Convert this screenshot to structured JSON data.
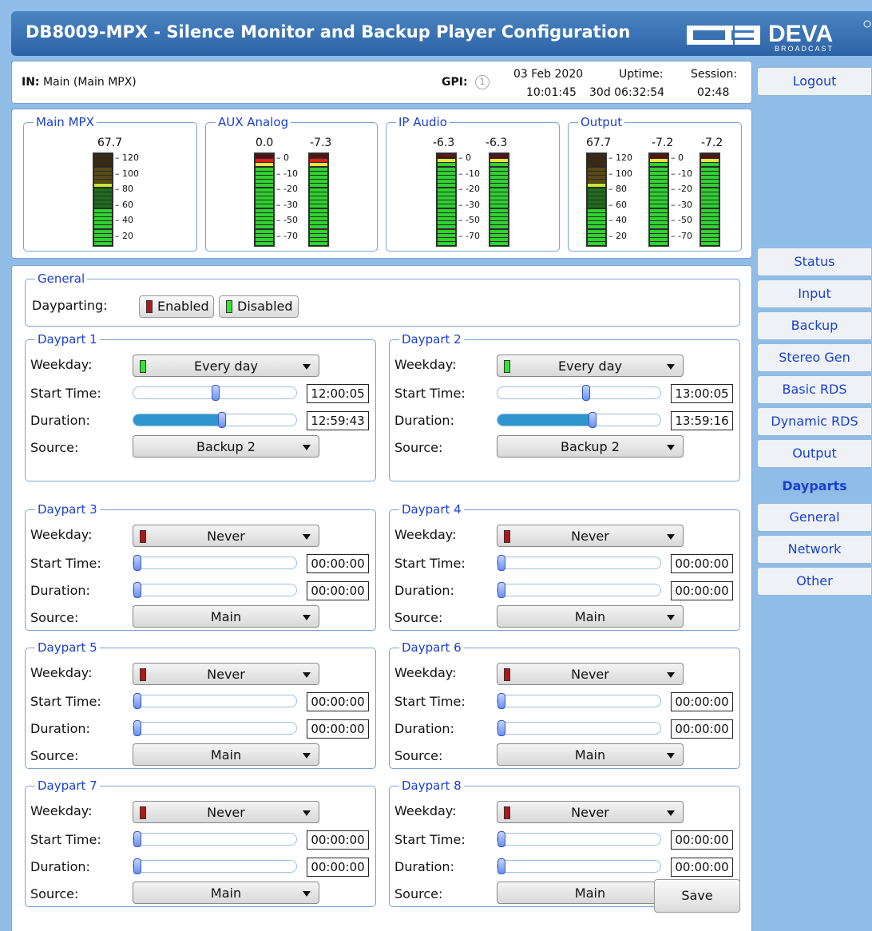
{
  "header": {
    "title": "DB8009-MPX - Silence Monitor and Backup Player Configuration",
    "logo_text": "DEVA",
    "logo_sub": "BROADCAST"
  },
  "infobar": {
    "in_label": "IN:",
    "in_value": "Main (Main MPX)",
    "gpi_label": "GPI:",
    "gpi_value": "1",
    "date": "03 Feb 2020",
    "time": "10:01:45",
    "uptime_label": "Uptime:",
    "uptime": "30d 06:32:54",
    "session_label": "Session:",
    "session": "02:48"
  },
  "meters": {
    "main_mpx": {
      "title": "Main MPX",
      "value": "67.7",
      "scale": [
        "120",
        "100",
        "80",
        "60",
        "40",
        "20"
      ]
    },
    "aux_analog": {
      "title": "AUX Analog",
      "left": "0.0",
      "right": "-7.3",
      "scale": [
        "0",
        "-10",
        "-20",
        "-30",
        "-50",
        "-70"
      ]
    },
    "ip_audio": {
      "title": "IP Audio",
      "left": "-6.3",
      "right": "-6.3",
      "scale": [
        "0",
        "-10",
        "-20",
        "-30",
        "-50",
        "-70"
      ]
    },
    "output": {
      "title": "Output",
      "mpx": "67.7",
      "left": "-7.2",
      "right": "-7.2",
      "mpx_scale": [
        "120",
        "100",
        "80",
        "60",
        "40",
        "20"
      ],
      "db_scale": [
        "0",
        "-10",
        "-20",
        "-30",
        "-50",
        "-70"
      ]
    }
  },
  "general": {
    "legend": "General",
    "dayparting_label": "Dayparting:",
    "enabled_label": "Enabled",
    "disabled_label": "Disabled"
  },
  "labels": {
    "weekday": "Weekday:",
    "start_time": "Start Time:",
    "duration": "Duration:",
    "source": "Source:"
  },
  "dayparts": [
    {
      "title": "Daypart 1",
      "weekday": "Every day",
      "weekday_state": "green",
      "start": "12:00:05",
      "start_pos": 0.5,
      "duration": "12:59:43",
      "duration_pos": 0.54,
      "source": "Backup 2"
    },
    {
      "title": "Daypart 2",
      "weekday": "Every day",
      "weekday_state": "green",
      "start": "13:00:05",
      "start_pos": 0.54,
      "duration": "13:59:16",
      "duration_pos": 0.58,
      "source": "Backup 2"
    },
    {
      "title": "Daypart 3",
      "weekday": "Never",
      "weekday_state": "red",
      "start": "00:00:00",
      "start_pos": 0,
      "duration": "00:00:00",
      "duration_pos": 0,
      "source": "Main"
    },
    {
      "title": "Daypart 4",
      "weekday": "Never",
      "weekday_state": "red",
      "start": "00:00:00",
      "start_pos": 0,
      "duration": "00:00:00",
      "duration_pos": 0,
      "source": "Main"
    },
    {
      "title": "Daypart 5",
      "weekday": "Never",
      "weekday_state": "red",
      "start": "00:00:00",
      "start_pos": 0,
      "duration": "00:00:00",
      "duration_pos": 0,
      "source": "Main"
    },
    {
      "title": "Daypart 6",
      "weekday": "Never",
      "weekday_state": "red",
      "start": "00:00:00",
      "start_pos": 0,
      "duration": "00:00:00",
      "duration_pos": 0,
      "source": "Main"
    },
    {
      "title": "Daypart 7",
      "weekday": "Never",
      "weekday_state": "red",
      "start": "00:00:00",
      "start_pos": 0,
      "duration": "00:00:00",
      "duration_pos": 0,
      "source": "Main"
    },
    {
      "title": "Daypart 8",
      "weekday": "Never",
      "weekday_state": "red",
      "start": "00:00:00",
      "start_pos": 0,
      "duration": "00:00:00",
      "duration_pos": 0,
      "source": "Main"
    }
  ],
  "save_label": "Save",
  "nav": {
    "logout": "Logout",
    "items": [
      "Status",
      "Input",
      "Backup",
      "Stereo Gen",
      "Basic RDS",
      "Dynamic RDS",
      "Output",
      "Dayparts",
      "General",
      "Network",
      "Other"
    ],
    "active": "Dayparts"
  },
  "colors": {
    "header": "#2c63a6",
    "link": "#1a3fd0",
    "background": "#8fbde8",
    "slider_fill": "#2e95cd",
    "enabled": "#b01818",
    "disabled": "#33e633"
  }
}
